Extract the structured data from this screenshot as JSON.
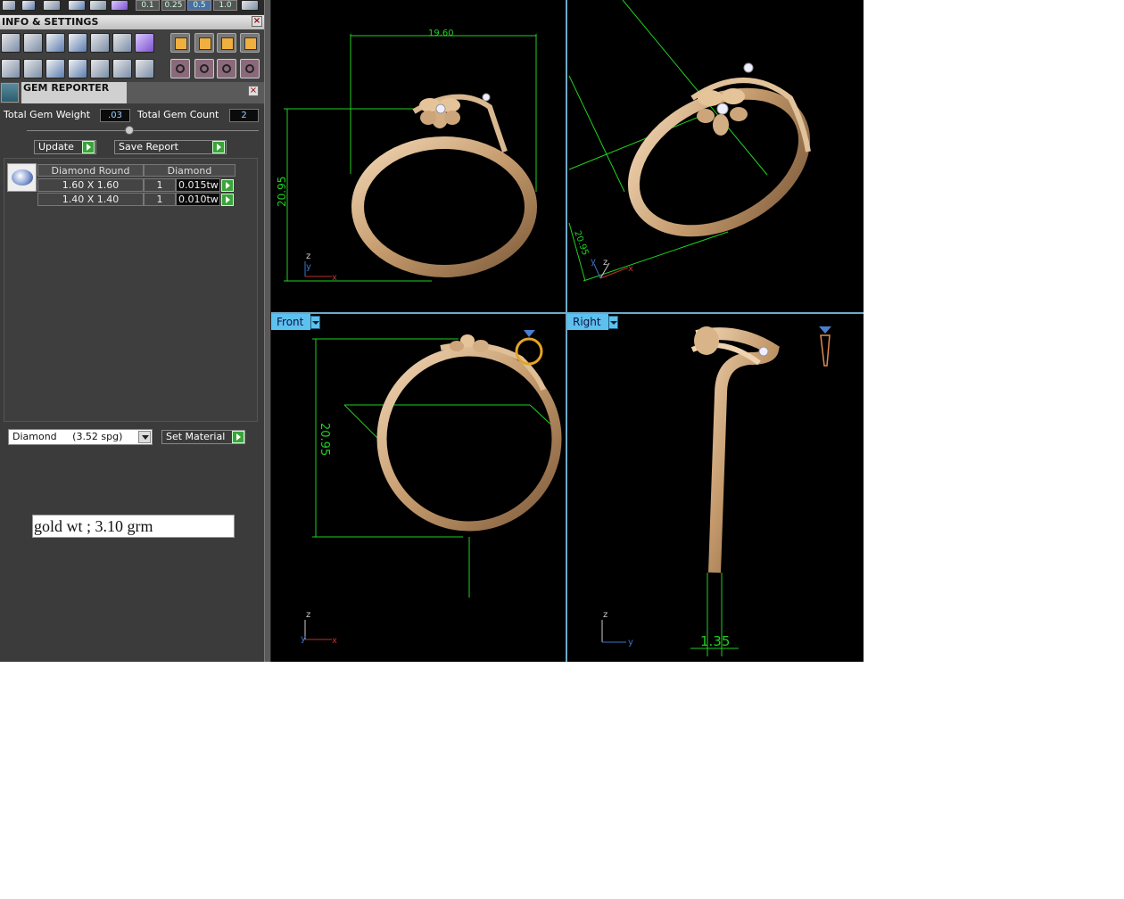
{
  "toolbar_top": {
    "snap_values": [
      "0.1",
      "0.25",
      "0.5",
      "1.0"
    ]
  },
  "info_settings": {
    "title": "INFO & SETTINGS",
    "close": "×"
  },
  "gem_reporter": {
    "title": "GEM REPORTER",
    "close": "×",
    "total_weight_label": "Total Gem Weight",
    "total_weight_value": ".03",
    "total_count_label": "Total Gem Count",
    "total_count_value": "2",
    "update_label": "Update",
    "save_label": "Save Report",
    "columns": [
      "Diamond Round",
      "Diamond"
    ],
    "rows": [
      {
        "size": "1.60 X 1.60",
        "qty": "1",
        "weight": "0.015tw"
      },
      {
        "size": "1.40 X 1.40",
        "qty": "1",
        "weight": "0.010tw"
      }
    ]
  },
  "material": {
    "selected": "Diamond     (3.52 spg)",
    "set_label": "Set Material"
  },
  "note": "gold wt ; 3.10 grm",
  "viewports": {
    "top_left": {
      "dim_width": "19.60",
      "dim_height": "20.95"
    },
    "top_right": {
      "dim_height": "20.95"
    },
    "front": {
      "label": "Front",
      "dim_height": "20.95"
    },
    "right": {
      "label": "Right",
      "dim_thickness": "1.35"
    }
  },
  "axes": {
    "x": "x",
    "y": "y",
    "z": "z"
  },
  "colors": {
    "dimension": "#1fd11f",
    "viewport_tab": "#5cc1ee",
    "gold": "#c9a27a"
  }
}
